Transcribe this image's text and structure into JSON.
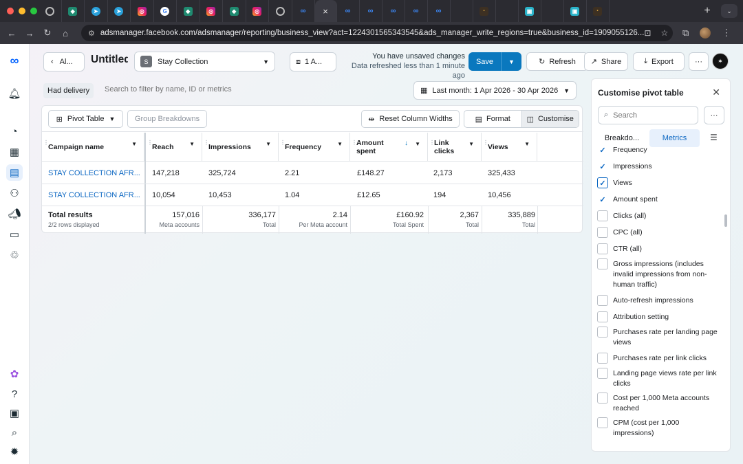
{
  "browser": {
    "url": "adsmanager.facebook.com/adsmanager/reporting/business_view?act=1224301565343545&ads_manager_write_regions=true&business_id=1909055126..."
  },
  "header": {
    "back_label": "Al...",
    "title": "Untitled",
    "account_initial": "S",
    "account_name": "Stay Collection",
    "ad_selector": "1 A...",
    "unsaved_title": "You have unsaved changes",
    "unsaved_sub": "Data refreshed less than 1 minute ago",
    "save_label": "Save",
    "refresh_label": "Refresh",
    "share_label": "Share",
    "export_label": "Export",
    "more_label": "···"
  },
  "filter": {
    "chip": "Had delivery",
    "placeholder": "Search to filter by name, ID or metrics",
    "date_range": "Last month: 1 Apr 2026 - 30 Apr 2026"
  },
  "toolbar": {
    "pivot_label": "Pivot Table",
    "group_label": "Group Breakdowns",
    "reset_label": "Reset Column Widths",
    "format_label": "Format",
    "customise_label": "Customise"
  },
  "table": {
    "columns": [
      "Campaign name",
      "Reach",
      "Impressions",
      "Frequency",
      "Amount spent",
      "Link clicks",
      "Views"
    ],
    "rows": [
      [
        "STAY COLLECTION AFR...",
        "147,218",
        "325,724",
        "2.21",
        "£148.27",
        "2,173",
        "325,433"
      ],
      [
        "STAY COLLECTION AFR...",
        "10,054",
        "10,453",
        "1.04",
        "£12.65",
        "194",
        "10,456"
      ]
    ],
    "totals": {
      "label": "Total results",
      "sub": "2/2 rows displayed",
      "values": [
        "157,016",
        "336,177",
        "2.14",
        "£160.92",
        "2,367",
        "335,889"
      ],
      "captions": [
        "Meta accounts",
        "Total",
        "Per Meta account",
        "Total Spent",
        "Total",
        "Total"
      ]
    }
  },
  "side": {
    "title": "Customise pivot table",
    "search_placeholder": "Search",
    "tab_breakdowns": "Breakdo...",
    "tab_metrics": "Metrics",
    "items": [
      {
        "label": "Frequency",
        "checked": true
      },
      {
        "label": "Impressions",
        "checked": true
      },
      {
        "label": "Views",
        "checked": true
      },
      {
        "label": "Amount spent",
        "checked": true
      },
      {
        "label": "Clicks (all)",
        "checked": false
      },
      {
        "label": "CPC (all)",
        "checked": false
      },
      {
        "label": "CTR (all)",
        "checked": false
      },
      {
        "label": "Gross impressions (includes invalid impressions from non-human traffic)",
        "checked": false
      },
      {
        "label": "Auto-refresh impressions",
        "checked": false
      },
      {
        "label": "Attribution setting",
        "checked": false
      },
      {
        "label": "Purchases rate per landing page views",
        "checked": false
      },
      {
        "label": "Purchases rate per link clicks",
        "checked": false
      },
      {
        "label": "Landing page views rate per link clicks",
        "checked": false
      },
      {
        "label": "Cost per 1,000 Meta accounts reached",
        "checked": false
      },
      {
        "label": "CPM (cost per 1,000 impressions)",
        "checked": false
      }
    ]
  },
  "colors": {
    "accent": "#0a78be",
    "link": "#0a66c2"
  }
}
